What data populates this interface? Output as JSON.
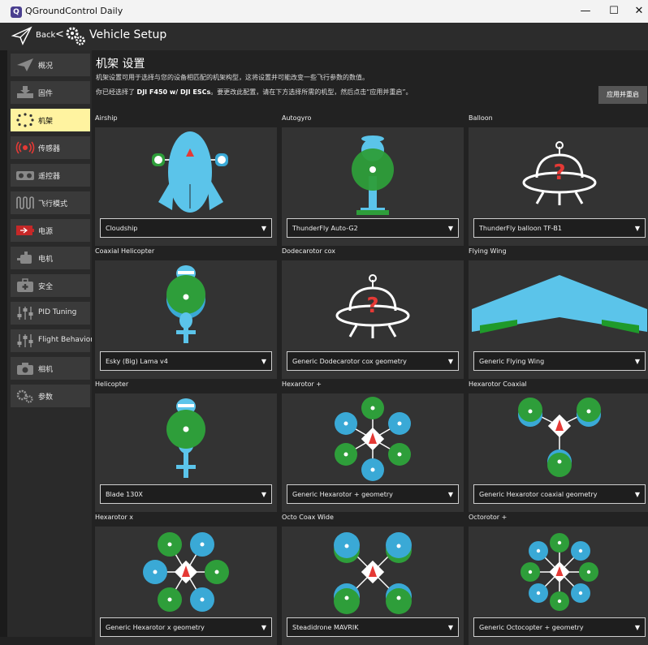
{
  "window": {
    "app_icon": "Q",
    "title": "QGroundControl Daily",
    "controls": {
      "minimize": "—",
      "maximize": "☐",
      "close": "✕"
    }
  },
  "toolbar": {
    "back_label": "Back",
    "separator": "<",
    "page_title": "Vehicle Setup"
  },
  "sidebar": {
    "items": [
      {
        "label": "概况"
      },
      {
        "label": "固件"
      },
      {
        "label": "机架"
      },
      {
        "label": "传感器"
      },
      {
        "label": "遥控器"
      },
      {
        "label": "飞行模式"
      },
      {
        "label": "电源"
      },
      {
        "label": "电机"
      },
      {
        "label": "安全"
      },
      {
        "label": "PID Tuning"
      },
      {
        "label": "Flight Behavior"
      },
      {
        "label": "相机"
      },
      {
        "label": "参数"
      }
    ],
    "active_index": 2
  },
  "main": {
    "heading": "机架 设置",
    "description": "机架设置可用于选择与您的设备相匹配的机架构型，这将设置并可能改变一些飞行参数的数值。",
    "current_prefix": "你已经选择了 ",
    "current_frame": "DJI F450 w/ DJI ESCs",
    "current_suffix": "。要更改此配置，请在下方选择所需的机型，然后点击“应用并重启”。",
    "apply_button": "应用并重启"
  },
  "frames": [
    {
      "category": "Airship",
      "selected": "Cloudship",
      "icon": "airship-icon"
    },
    {
      "category": "Autogyro",
      "selected": "ThunderFly Auto-G2",
      "icon": "autogyro-icon"
    },
    {
      "category": "Balloon",
      "selected": "ThunderFly balloon TF-B1",
      "icon": "unknown-frame-icon"
    },
    {
      "category": "Coaxial Helicopter",
      "selected": "Esky (Big) Lama v4",
      "icon": "coaxial-helicopter-icon"
    },
    {
      "category": "Dodecarotor cox",
      "selected": "Generic Dodecarotor cox geometry",
      "icon": "unknown-frame-icon"
    },
    {
      "category": "Flying Wing",
      "selected": "Generic Flying Wing",
      "icon": "flying-wing-icon"
    },
    {
      "category": "Helicopter",
      "selected": "Blade 130X",
      "icon": "helicopter-icon"
    },
    {
      "category": "Hexarotor +",
      "selected": "Generic Hexarotor + geometry",
      "icon": "hexarotor-plus-icon"
    },
    {
      "category": "Hexarotor Coaxial",
      "selected": "Generic Hexarotor coaxial geometry",
      "icon": "hexarotor-coaxial-icon"
    },
    {
      "category": "Hexarotor x",
      "selected": "Generic Hexarotor x geometry",
      "icon": "hexarotor-x-icon"
    },
    {
      "category": "Octo Coax Wide",
      "selected": "Steadidrone MAVRIK",
      "icon": "octo-coax-icon"
    },
    {
      "category": "Octorotor +",
      "selected": "Generic Octocopter + geometry",
      "icon": "octorotor-plus-icon"
    }
  ],
  "colors": {
    "active_nav": "#fff3a0",
    "rotor_blue": "#3aa9d6",
    "rotor_green": "#2e9e3a",
    "body_blue": "#5bc4ea",
    "arrow_red": "#e53935",
    "wing_green": "#1f9a2a"
  }
}
